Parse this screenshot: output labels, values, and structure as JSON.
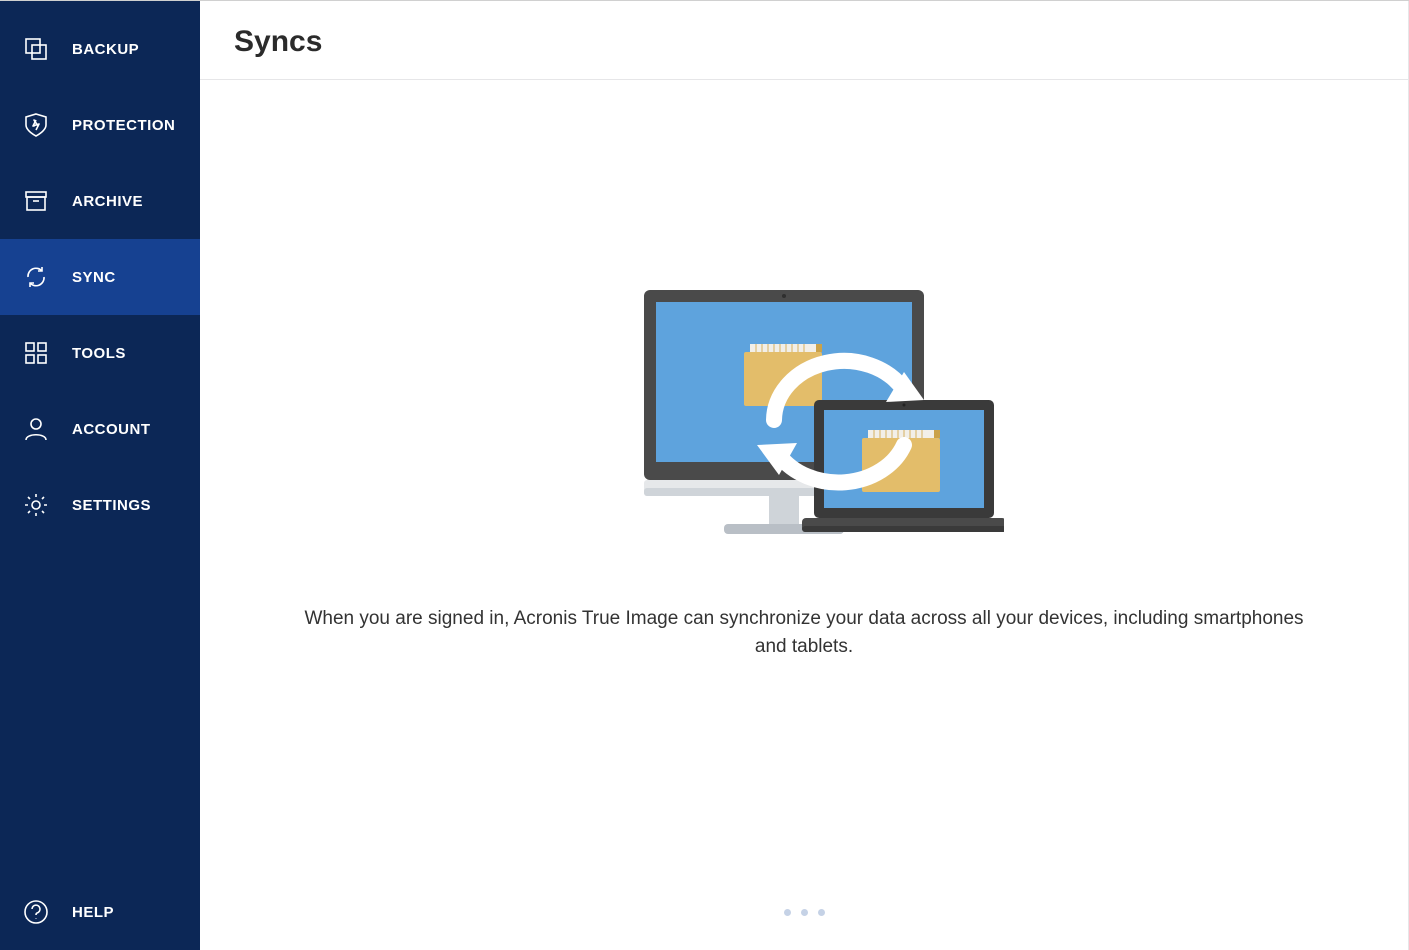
{
  "sidebar": {
    "items": [
      {
        "label": "BACKUP",
        "icon": "backup-icon",
        "active": false
      },
      {
        "label": "PROTECTION",
        "icon": "protection-icon",
        "active": false
      },
      {
        "label": "ARCHIVE",
        "icon": "archive-icon",
        "active": false
      },
      {
        "label": "SYNC",
        "icon": "sync-icon",
        "active": true
      },
      {
        "label": "TOOLS",
        "icon": "tools-icon",
        "active": false
      },
      {
        "label": "ACCOUNT",
        "icon": "account-icon",
        "active": false
      },
      {
        "label": "SETTINGS",
        "icon": "settings-icon",
        "active": false
      }
    ],
    "help": {
      "label": "HELP",
      "icon": "help-icon"
    }
  },
  "main": {
    "title": "Syncs",
    "description": "When you are signed in, Acronis True Image can synchronize your data across all your devices, including smartphones and tablets.",
    "pager_count": 3
  }
}
